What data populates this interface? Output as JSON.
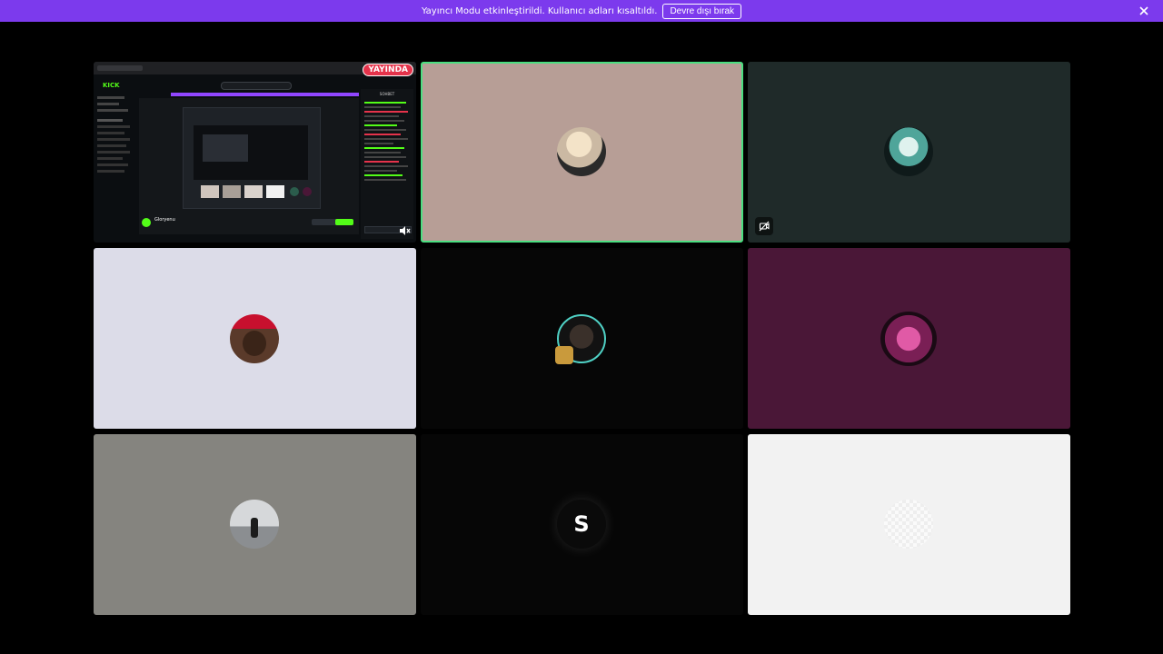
{
  "banner": {
    "text": "Yayıncı Modu etkinleştirildi. Kullanıcı adları kısaltıldı.",
    "button_label": "Devre dışı bırak",
    "color": "#7c3aed"
  },
  "tiles": {
    "screen_share": {
      "live_label": "YAYINDA",
      "app_logo": "KICK",
      "stream_title": "Gloryenu",
      "chat_header": "SOHBET"
    },
    "participants": [
      {
        "id": "p1",
        "bg": "#b79e96",
        "speaking": true
      },
      {
        "id": "p2",
        "bg": "#1f2a29",
        "camera_off_icon": "camera-off-icon"
      },
      {
        "id": "p3",
        "bg": "#dcdce8"
      },
      {
        "id": "p4",
        "bg": "#060606"
      },
      {
        "id": "p5",
        "bg": "#4a1737"
      },
      {
        "id": "p6",
        "bg": "#85847f"
      },
      {
        "id": "p7",
        "bg": "#060606",
        "initial": "S"
      },
      {
        "id": "p8",
        "bg": "#f2f2f2"
      }
    ]
  },
  "colors": {
    "speaking_border": "#4ade80",
    "live_badge": "#e5334b",
    "kick_green": "#53fc18"
  }
}
